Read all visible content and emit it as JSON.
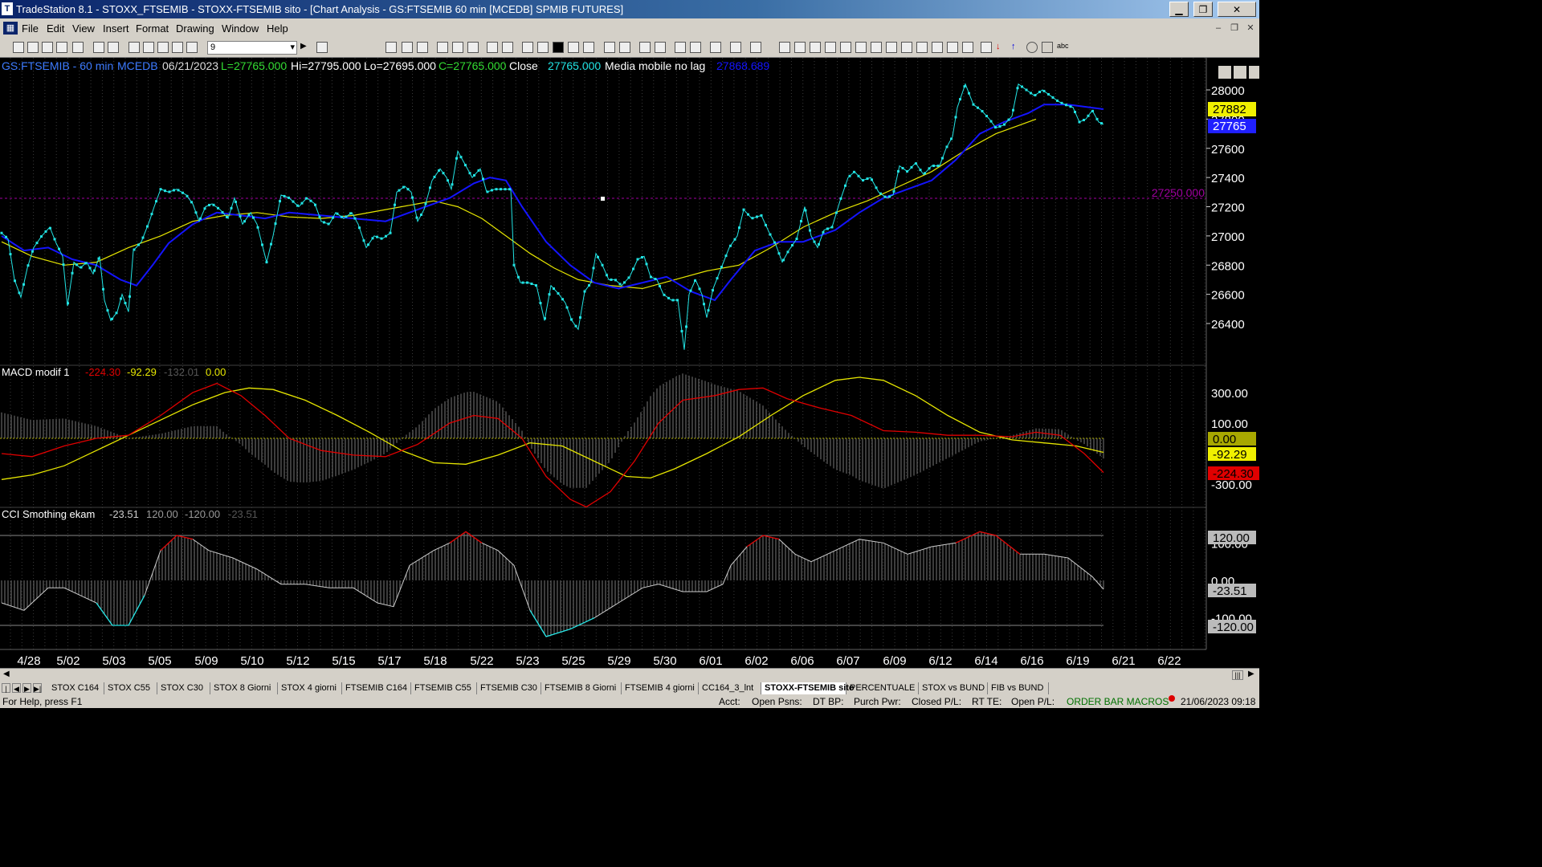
{
  "window": {
    "title": "TradeStation 8.1 - STOXX_FTSEMIB - STOXX-FTSEMIB sito - [Chart Analysis - GS:FTSEMIB 60 min [MCEDB] SPMIB FUTURES]",
    "app_icon": "tradestation-icon",
    "min": "▁",
    "max": "❐",
    "close": "✕"
  },
  "menu": {
    "items": [
      "File",
      "Edit",
      "View",
      "Insert",
      "Format",
      "Drawing",
      "Window",
      "Help"
    ],
    "mdi_min": "–",
    "mdi_restore": "❐",
    "mdi_close": "✕"
  },
  "toolbar": {
    "interval_value": "9"
  },
  "chart": {
    "header": {
      "symbol": "GS:FTSEMIB - 60 min",
      "exchange": "MCEDB",
      "date": "06/21/2023",
      "last": "L=27765.000",
      "high": "Hi=27795.000",
      "low": "Lo=27695.000",
      "close": "C=27765.000",
      "close_label": "Close",
      "close_value": "27765.000",
      "ma_label": "Media mobile no lag",
      "ma_value": "27868.689"
    },
    "price_axis": {
      "ticks": [
        "28000",
        "27800",
        "27600",
        "27400",
        "27200",
        "27000",
        "26800",
        "26600",
        "26400"
      ],
      "tick_values": [
        28000,
        27800,
        27600,
        27400,
        27200,
        27000,
        26800,
        26600,
        26400
      ],
      "label_yellow": "27882",
      "label_blue": "27765",
      "hline_label": "27250.000"
    },
    "macd": {
      "label": "MACD modif 1",
      "v1": "-224.30",
      "v2": "-92.29",
      "v3": "-132.01",
      "v4": "0.00",
      "ticks": [
        "300.00",
        "100.00",
        "-300.00"
      ],
      "tick_values": [
        300,
        100,
        -300
      ],
      "lbl_zero": "0.00",
      "lbl_yellow": "-92.29",
      "lbl_red": "-224.30"
    },
    "cci": {
      "label": "CCI Smothing ekam",
      "v1": "-23.51",
      "v2": "120.00",
      "v3": "-120.00",
      "v4": "-23.51",
      "ticks": [
        "100.00",
        "0.00",
        "-100.00"
      ],
      "tick_values": [
        100,
        0,
        -100
      ],
      "lbl_top": "120.00",
      "lbl_val": "-23.51",
      "lbl_bot": "-120.00"
    },
    "dates": [
      "4/28",
      "5/02",
      "5/03",
      "5/05",
      "5/09",
      "5/10",
      "5/12",
      "5/15",
      "5/17",
      "5/18",
      "5/22",
      "5/23",
      "5/25",
      "5/29",
      "5/30",
      "6/01",
      "6/02",
      "6/06",
      "6/07",
      "6/09",
      "6/12",
      "6/14",
      "6/16",
      "6/19",
      "6/21",
      "6/22"
    ]
  },
  "chart_data": {
    "type": "line",
    "x": [
      "4/28",
      "5/02",
      "5/03",
      "5/05",
      "5/09",
      "5/10",
      "5/12",
      "5/15",
      "5/17",
      "5/18",
      "5/22",
      "5/23",
      "5/25",
      "5/29",
      "5/30",
      "6/01",
      "6/02",
      "6/06",
      "6/07",
      "6/09",
      "6/12",
      "6/14",
      "6/16",
      "6/19",
      "6/21"
    ],
    "series": [
      {
        "name": "Close",
        "values": [
          27020,
          26800,
          26550,
          27250,
          27150,
          27150,
          27150,
          27000,
          27250,
          27450,
          27320,
          26650,
          26400,
          26720,
          26700,
          26900,
          27100,
          27000,
          27400,
          27300,
          27600,
          27850,
          27950,
          27850,
          27765
        ]
      },
      {
        "name": "Media mobile no lag",
        "values": [
          26950,
          26850,
          26700,
          27000,
          27150,
          27150,
          27120,
          27080,
          27200,
          27250,
          27380,
          26900,
          26700,
          26680,
          26680,
          26620,
          26900,
          27000,
          27200,
          27300,
          27500,
          27750,
          27880,
          27900,
          27868.689
        ]
      }
    ],
    "hline": 27250,
    "ylim": [
      26300,
      28100
    ]
  },
  "tabs": [
    "STOX C164",
    "STOX C55",
    "STOX C30",
    "STOX 8 Giorni",
    "STOX 4 giorni",
    "FTSEMIB C164",
    "FTSEMIB C55",
    "FTSEMIB C30",
    "FTSEMIB 8 Giorni",
    "FTSEMIB 4 giorni",
    "CC164_3_lnt",
    "STOXX-FTSEMIB sito",
    "PERCENTUALE",
    "STOX vs BUND",
    "FIB vs BUND"
  ],
  "active_tab": "STOXX-FTSEMIB sito",
  "status": {
    "help": "For Help, press F1",
    "acct": "Acct:",
    "open_psns": "Open Psns:",
    "dt_bp": "DT BP:",
    "purch_pwr": "Purch Pwr:",
    "closed_pl": "Closed P/L:",
    "rt_te": "RT TE:",
    "open_pl": "Open P/L:",
    "macros": "ORDER BAR  MACROS",
    "datetime": "21/06/2023 09:18"
  },
  "colors": {
    "price": "#22e4e4",
    "blue_ma": "#1010ff",
    "yellow_ma": "#e6e600",
    "macd_red": "#e00000",
    "grid": "#505050",
    "hline": "#a000a0"
  }
}
